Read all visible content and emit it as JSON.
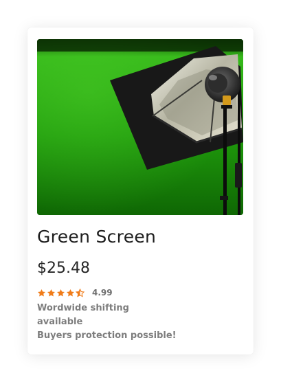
{
  "product": {
    "title": "Green Screen",
    "price": "$25.48",
    "rating": {
      "value": "4.99",
      "stars_filled": 4.5,
      "stars_total": 5,
      "star_color": "#f07c1a"
    },
    "shipping_text": "Wordwide shifting available",
    "protection_text": "Buyers protection possible!",
    "image_icon": "product-photo-green-screen-studio-light"
  },
  "colors": {
    "card_background": "#ffffff",
    "title": "#1e1e1e",
    "meta_text": "#7d7d7d"
  }
}
